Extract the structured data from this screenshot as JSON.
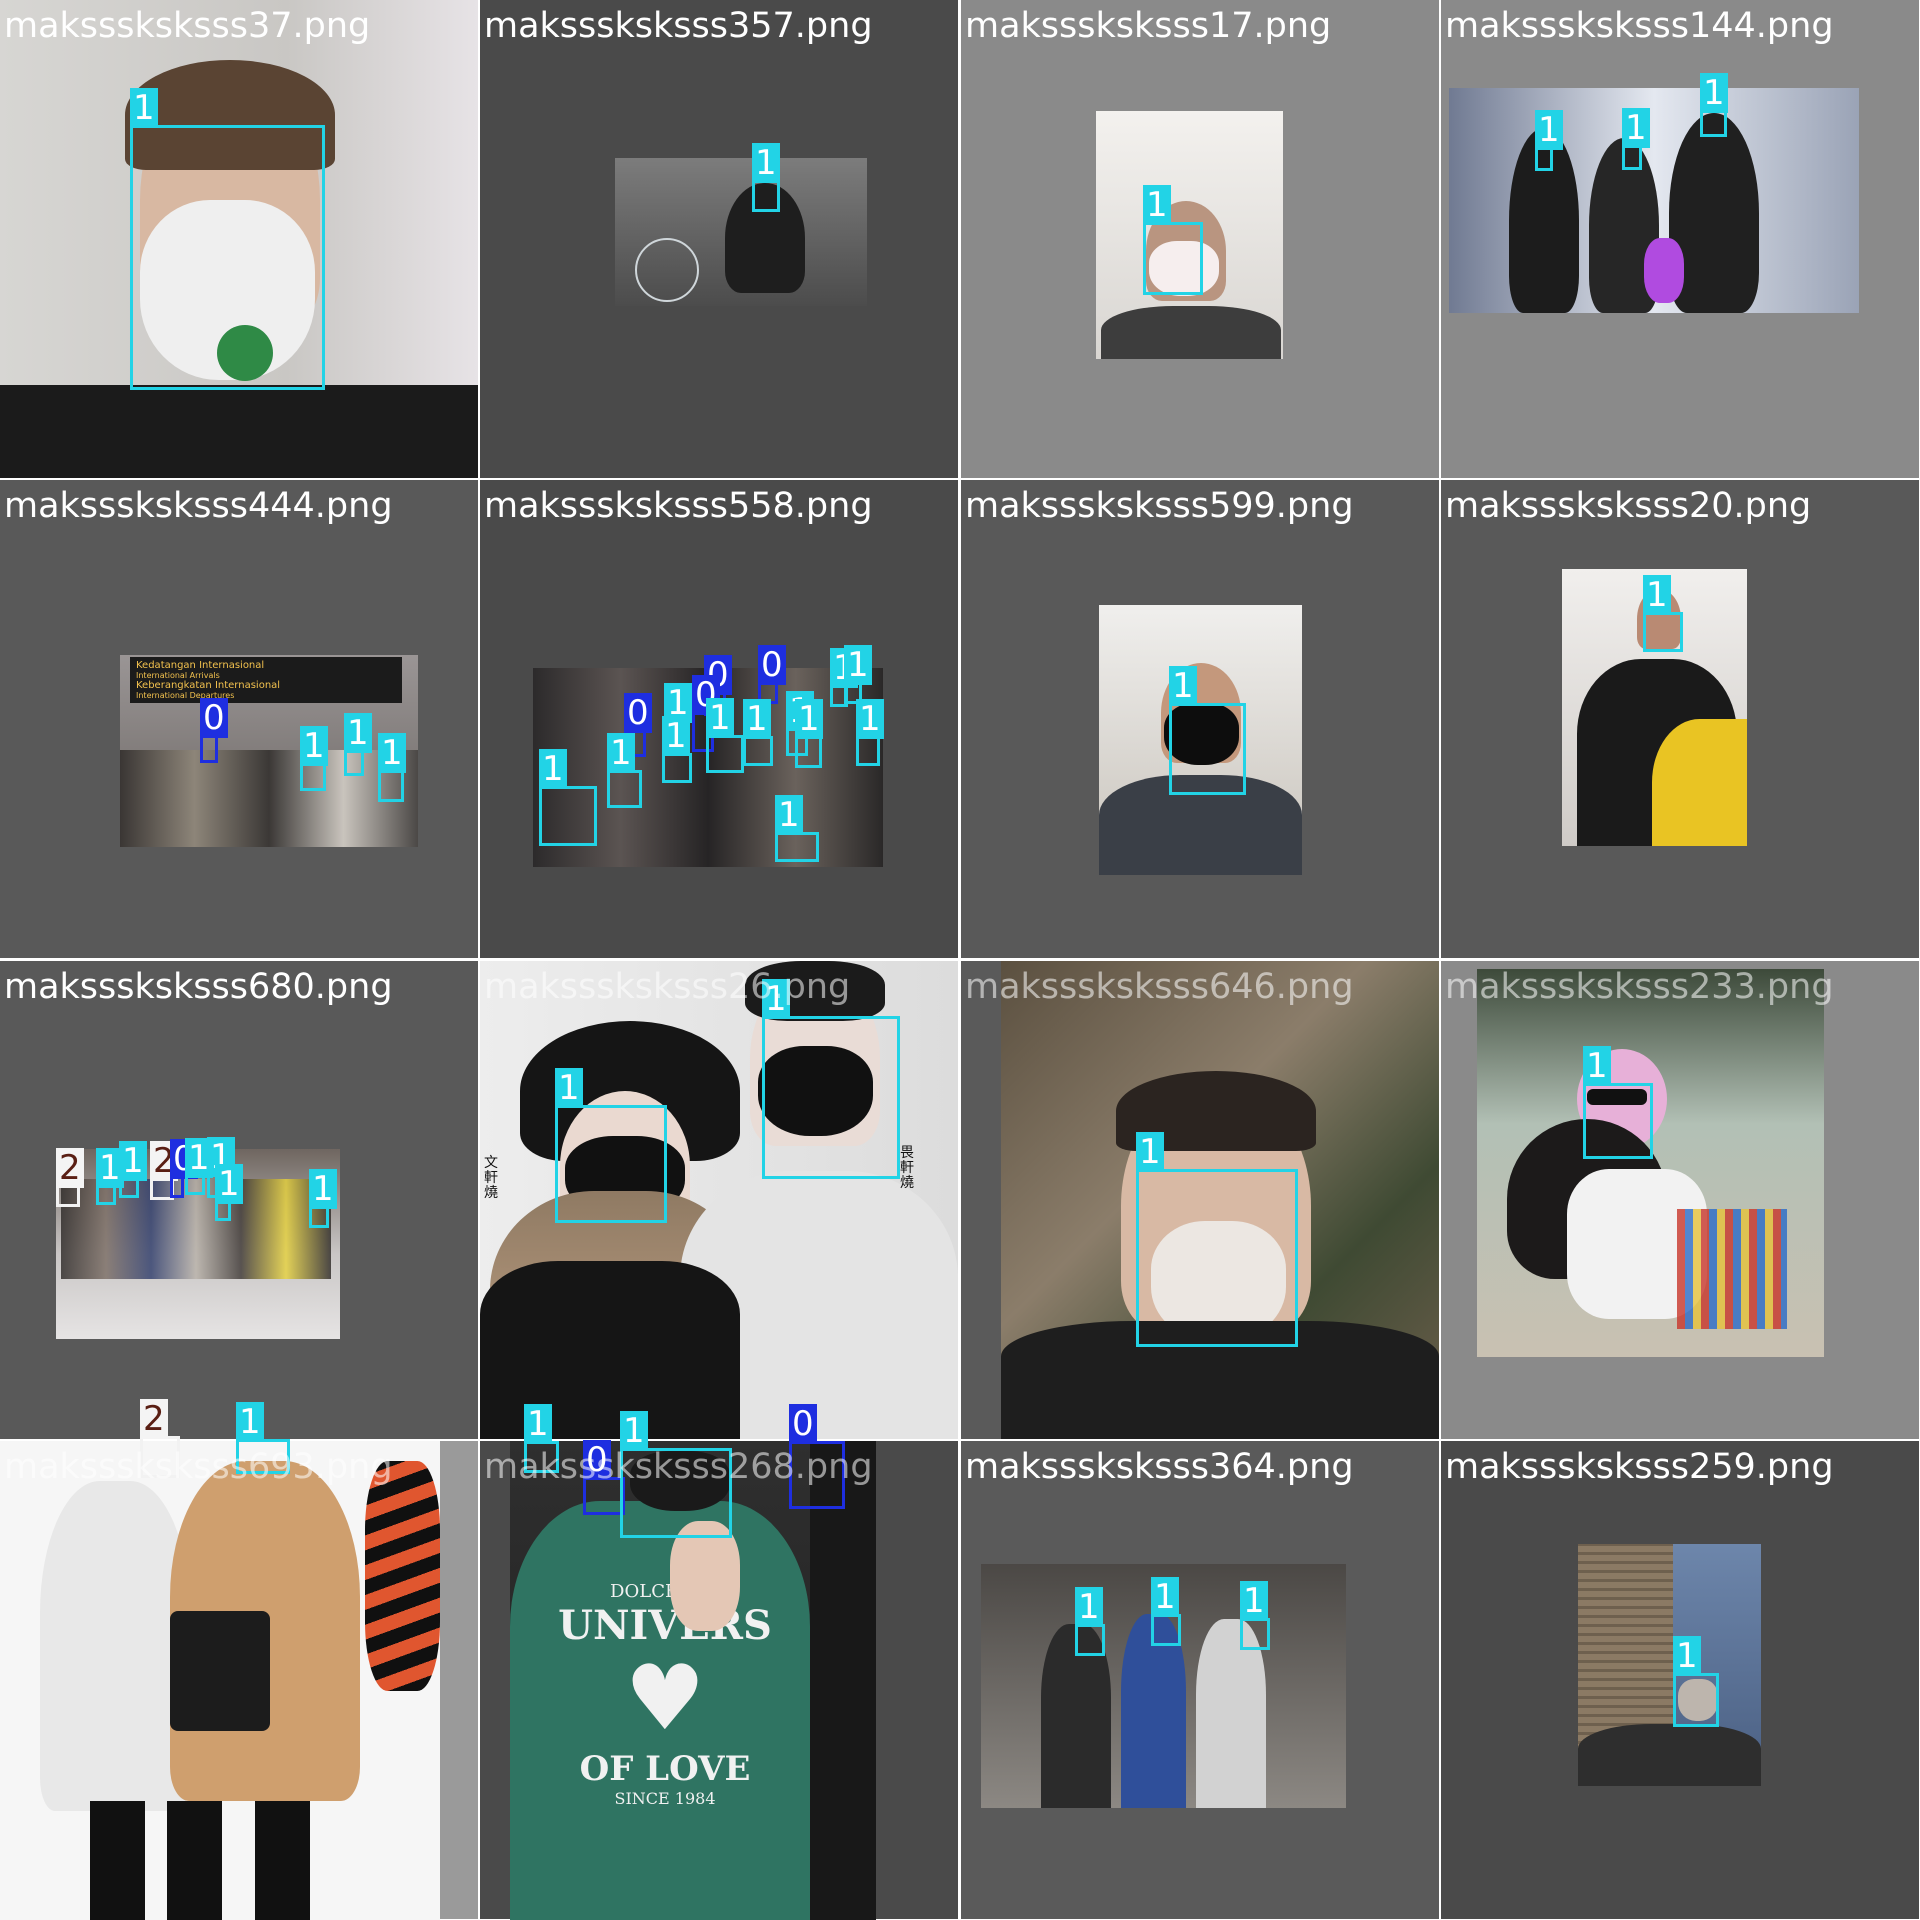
{
  "tiles": [
    {
      "filename": "maksssksksss37.png",
      "bg": "#dcdcdc",
      "photo": {
        "bg": "#b8b5b2"
      },
      "boxes": [
        {
          "cls": "1"
        }
      ]
    },
    {
      "filename": "maksssksksss357.png",
      "bg": "#4a4a4a",
      "photo": {
        "bg": "#5c5c5c"
      },
      "boxes": [
        {
          "cls": "1"
        }
      ]
    },
    {
      "filename": "maksssksksss17.png",
      "bg": "#8a8a8a",
      "photo": {
        "bg": "#d9d9d9"
      },
      "boxes": [
        {
          "cls": "1"
        }
      ]
    },
    {
      "filename": "maksssksksss144.png",
      "bg": "#8a8a8a",
      "photo": {
        "bg": "#c9d2e3"
      },
      "boxes": [
        {
          "cls": "1"
        },
        {
          "cls": "1"
        },
        {
          "cls": "1"
        }
      ]
    },
    {
      "filename": "maksssksksss444.png",
      "bg": "#595959",
      "photo": {
        "bg": "#8a8480"
      },
      "sign_lines": [
        "Kedatangan Internasional",
        "International Arrivals",
        "Keberangkatan Internasional",
        "International Departures"
      ],
      "boxes": [
        {
          "cls": "0"
        },
        {
          "cls": "1"
        },
        {
          "cls": "1"
        },
        {
          "cls": "1"
        }
      ]
    },
    {
      "filename": "maksssksksss558.png",
      "bg": "#4a4a4a",
      "photo": {
        "bg": "#3e3a3a"
      },
      "boxes": [
        {
          "cls": "1"
        },
        {
          "cls": "0"
        },
        {
          "cls": "0"
        },
        {
          "cls": "0"
        },
        {
          "cls": "1"
        },
        {
          "cls": "1"
        },
        {
          "cls": "1"
        },
        {
          "cls": "0"
        },
        {
          "cls": "1"
        },
        {
          "cls": "1"
        },
        {
          "cls": "1"
        },
        {
          "cls": "1"
        },
        {
          "cls": "1"
        },
        {
          "cls": "1"
        },
        {
          "cls": "1"
        },
        {
          "cls": "1"
        }
      ]
    },
    {
      "filename": "maksssksksss599.png",
      "bg": "#595959",
      "photo": {
        "bg": "#cfc9c1"
      },
      "boxes": [
        {
          "cls": "1"
        }
      ]
    },
    {
      "filename": "maksssksksss20.png",
      "bg": "#595959",
      "photo": {
        "bg": "#e2e0dd"
      },
      "boxes": [
        {
          "cls": "1"
        }
      ]
    },
    {
      "filename": "maksssksksss680.png",
      "bg": "#595959",
      "photo": {
        "bg": "#a9a4a0"
      },
      "boxes": [
        {
          "cls": "2"
        },
        {
          "cls": "1"
        },
        {
          "cls": "1"
        },
        {
          "cls": "2"
        },
        {
          "cls": "0"
        },
        {
          "cls": "1"
        },
        {
          "cls": "1"
        },
        {
          "cls": "1"
        },
        {
          "cls": "1"
        }
      ]
    },
    {
      "filename": "maksssksksss26.png",
      "bg": "#e8e8e8",
      "photo": {
        "bg": "#e6e6e6"
      },
      "side_text_left": "文軒燒",
      "side_text_right": "畏軒燒",
      "boxes": [
        {
          "cls": "1"
        },
        {
          "cls": "1"
        }
      ]
    },
    {
      "filename": "maksssksksss646.png",
      "bg": "#5a5a5a",
      "photo": {
        "bg": "#6b5d4c"
      },
      "boxes": [
        {
          "cls": "1"
        }
      ]
    },
    {
      "filename": "maksssksksss233.png",
      "bg": "#8a8a8a",
      "photo": {
        "bg": "#7d8a74"
      },
      "boxes": [
        {
          "cls": "1"
        }
      ]
    },
    {
      "filename": "maksssksksss693.png",
      "bg": "#9a9a9a",
      "photo": {
        "bg": "#f4f4f4"
      },
      "boxes": [
        {
          "cls": "2"
        },
        {
          "cls": "1"
        }
      ]
    },
    {
      "filename": "maksssksksss268.png",
      "bg": "#4a4a4a",
      "photo": {
        "bg": "#3c7060"
      },
      "shirt_lines": [
        "DOLCE & G",
        "UNIVERS",
        "OF LOVE",
        "SINCE 1984"
      ],
      "boxes": [
        {
          "cls": "1"
        },
        {
          "cls": "0"
        },
        {
          "cls": "1"
        },
        {
          "cls": "0"
        }
      ]
    },
    {
      "filename": "maksssksksss364.png",
      "bg": "#5a5a5a",
      "photo": {
        "bg": "#6c6a68"
      },
      "boxes": [
        {
          "cls": "1"
        },
        {
          "cls": "1"
        },
        {
          "cls": "1"
        }
      ]
    },
    {
      "filename": "maksssksksss259.png",
      "bg": "#4a4a4a",
      "photo": {
        "bg": "#5b6f8e"
      },
      "boxes": [
        {
          "cls": "1"
        }
      ]
    }
  ]
}
